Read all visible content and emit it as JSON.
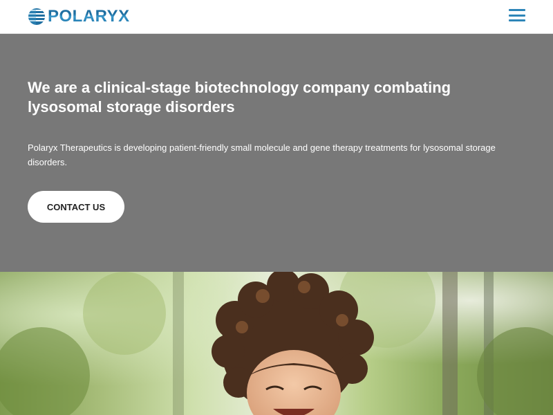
{
  "header": {
    "logo_text": "POLARYX",
    "menu_icon": "hamburger-menu-icon",
    "brand_color": "#2e86b8"
  },
  "hero": {
    "title": "We are a clinical-stage biotechnology company combating lysosomal storage disorders",
    "description": "Polaryx Therapeutics is developing patient-friendly small molecule and gene therapy treatments for lysosomal storage disorders.",
    "cta_label": "CONTACT US",
    "background_color": "#787878"
  },
  "photo": {
    "subject": "child-photo"
  }
}
